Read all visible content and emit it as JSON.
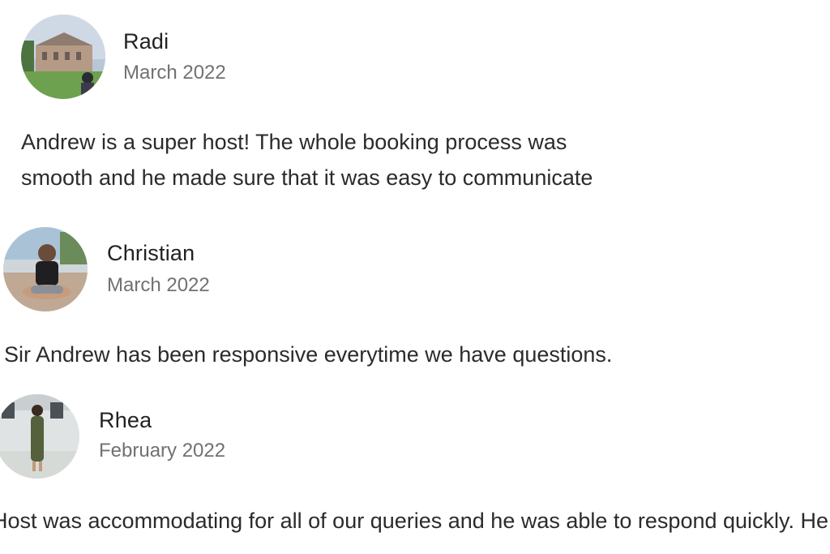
{
  "reviews": [
    {
      "name": "Radi",
      "date": "March 2022",
      "text_lines": [
        "Andrew is a super host! The whole booking process was",
        "smooth and he made sure that it was easy to communicate"
      ],
      "avatar_icon": "user-photo-icon"
    },
    {
      "name": "Christian",
      "date": "March 2022",
      "text_lines": [
        "Sir Andrew has been responsive everytime we have questions."
      ],
      "avatar_icon": "user-photo-icon"
    },
    {
      "name": "Rhea",
      "date": "February 2022",
      "text_lines": [
        "Host was accommodating for all of our queries and he was able to respond quickly. He"
      ],
      "avatar_icon": "user-photo-icon"
    }
  ]
}
